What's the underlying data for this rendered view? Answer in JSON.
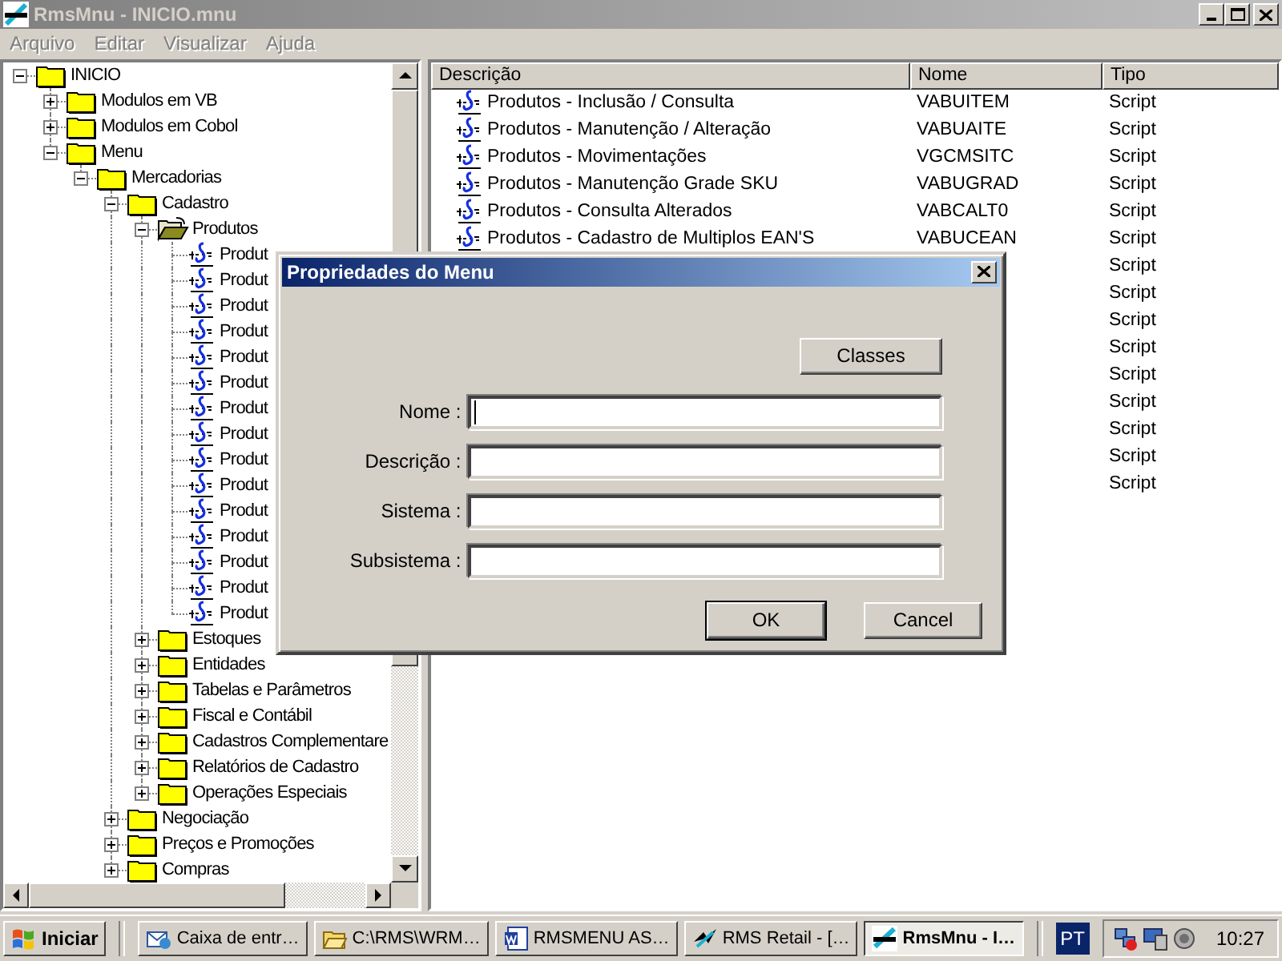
{
  "window": {
    "title": "RmsMnu - INICIO.mnu",
    "active": false
  },
  "menu": [
    {
      "label": "Arquivo",
      "disabled": true
    },
    {
      "label": "Editar",
      "disabled": true
    },
    {
      "label": "Visualizar",
      "disabled": true
    },
    {
      "label": "Ajuda",
      "disabled": true
    }
  ],
  "tree": [
    {
      "label": "INICIO",
      "kind": "folder",
      "expanded": true,
      "selected": false,
      "children": [
        {
          "label": "Modulos em VB",
          "kind": "folder",
          "expanded": false,
          "selected": false
        },
        {
          "label": "Modulos em Cobol",
          "kind": "folder",
          "expanded": false,
          "selected": false
        },
        {
          "label": "Menu",
          "kind": "folder",
          "expanded": true,
          "selected": false,
          "children": [
            {
              "label": "Mercadorias",
              "kind": "folder",
              "expanded": true,
              "selected": false,
              "children": [
                {
                  "label": "Cadastro",
                  "kind": "folder",
                  "expanded": true,
                  "selected": false,
                  "children": [
                    {
                      "label": "Produtos",
                      "kind": "folder",
                      "expanded": true,
                      "selected": true,
                      "children": [
                        {
                          "label": "Produt",
                          "kind": "script"
                        },
                        {
                          "label": "Produt",
                          "kind": "script"
                        },
                        {
                          "label": "Produt",
                          "kind": "script"
                        },
                        {
                          "label": "Produt",
                          "kind": "script"
                        },
                        {
                          "label": "Produt",
                          "kind": "script"
                        },
                        {
                          "label": "Produt",
                          "kind": "script"
                        },
                        {
                          "label": "Produt",
                          "kind": "script"
                        },
                        {
                          "label": "Produt",
                          "kind": "script"
                        },
                        {
                          "label": "Produt",
                          "kind": "script"
                        },
                        {
                          "label": "Produt",
                          "kind": "script"
                        },
                        {
                          "label": "Produt",
                          "kind": "script"
                        },
                        {
                          "label": "Produt",
                          "kind": "script"
                        },
                        {
                          "label": "Produt",
                          "kind": "script"
                        },
                        {
                          "label": "Produt",
                          "kind": "script"
                        },
                        {
                          "label": "Produt",
                          "kind": "script"
                        }
                      ]
                    },
                    {
                      "label": "Estoques",
                      "kind": "folder",
                      "expanded": false,
                      "selected": false
                    },
                    {
                      "label": "Entidades",
                      "kind": "folder",
                      "expanded": false,
                      "selected": false
                    },
                    {
                      "label": "Tabelas e Parâmetros",
                      "kind": "folder",
                      "expanded": false,
                      "selected": false
                    },
                    {
                      "label": "Fiscal e Contábil",
                      "kind": "folder",
                      "expanded": false,
                      "selected": false
                    },
                    {
                      "label": "Cadastros Complementare",
                      "kind": "folder",
                      "expanded": false,
                      "selected": false
                    },
                    {
                      "label": "Relatórios de Cadastro",
                      "kind": "folder",
                      "expanded": false,
                      "selected": false
                    },
                    {
                      "label": "Operações Especiais",
                      "kind": "folder",
                      "expanded": false,
                      "selected": false
                    }
                  ]
                },
                {
                  "label": "Negociação",
                  "kind": "folder",
                  "expanded": false,
                  "selected": false
                },
                {
                  "label": "Preços e Promoções",
                  "kind": "folder",
                  "expanded": false,
                  "selected": false
                },
                {
                  "label": "Compras",
                  "kind": "folder",
                  "expanded": false,
                  "selected": false
                }
              ]
            }
          ]
        }
      ]
    }
  ],
  "list": {
    "columns": [
      {
        "label": "Descrição"
      },
      {
        "label": "Nome"
      },
      {
        "label": "Tipo"
      }
    ],
    "rows": [
      {
        "description": "Produtos - Inclusão / Consulta",
        "name": "VABUITEM",
        "type": "Script"
      },
      {
        "description": "Produtos - Manutenção / Alteração",
        "name": "VABUAITE",
        "type": "Script"
      },
      {
        "description": "Produtos - Movimentações",
        "name": "VGCMSITC",
        "type": "Script"
      },
      {
        "description": "Produtos - Manutenção Grade SKU",
        "name": "VABUGRAD",
        "type": "Script"
      },
      {
        "description": "Produtos - Consulta Alterados",
        "name": "VABCALT0",
        "type": "Script"
      },
      {
        "description": "Produtos - Cadastro de Multiplos EAN'S",
        "name": "VABUCEAN",
        "type": "Script"
      },
      {
        "type": "Script"
      },
      {
        "type": "Script"
      },
      {
        "type": "Script"
      },
      {
        "type": "Script"
      },
      {
        "type": "Script"
      },
      {
        "type": "Script"
      },
      {
        "type": "Script"
      },
      {
        "type": "Script"
      },
      {
        "type": "Script"
      }
    ]
  },
  "dialog": {
    "title": "Propriedades do Menu",
    "classes_button": "Classes",
    "fields": [
      {
        "label": "Nome :",
        "focused": true
      },
      {
        "label": "Descrição :",
        "focused": false
      },
      {
        "label": "Sistema :",
        "focused": false
      },
      {
        "label": "Subsistema :",
        "focused": false
      }
    ],
    "buttons": [
      {
        "label": "OK",
        "default": true
      },
      {
        "label": "Cancel",
        "default": false
      }
    ]
  },
  "taskbar": {
    "start": "Iniciar",
    "tasks": [
      {
        "label": "Caixa de entr…",
        "selected": false
      },
      {
        "label": "C:\\RMS\\WRM…",
        "selected": false
      },
      {
        "label": "RMSMENU AS…",
        "selected": false
      },
      {
        "label": "RMS Retail - […",
        "selected": false
      },
      {
        "label": "RmsMnu - I…",
        "selected": true
      }
    ],
    "language": "PT",
    "clock": "10:27"
  }
}
